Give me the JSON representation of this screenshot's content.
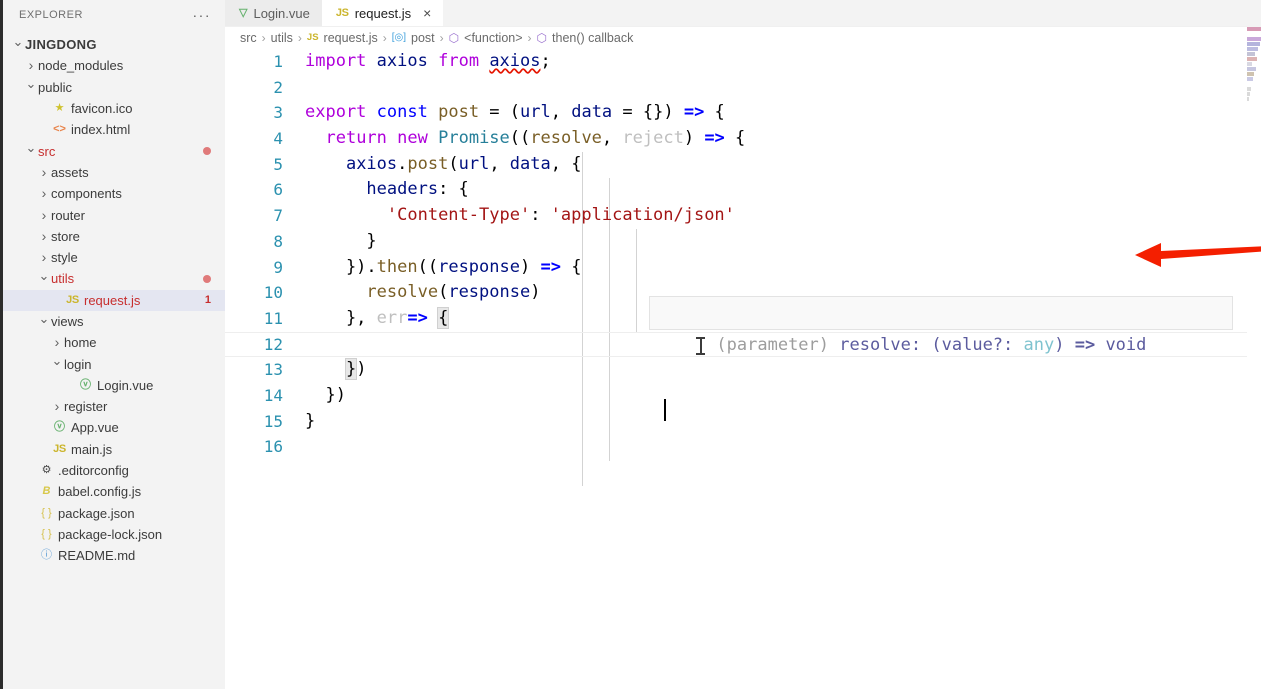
{
  "sidebar": {
    "title": "EXPLORER",
    "more_label": "···",
    "items": [
      {
        "label": "JINGDONG",
        "indent": 0,
        "twisty": "down",
        "icon": "",
        "kind": "root",
        "badge": ""
      },
      {
        "label": "node_modules",
        "indent": 1,
        "twisty": "right",
        "icon": "",
        "kind": "folder",
        "badge": ""
      },
      {
        "label": "public",
        "indent": 1,
        "twisty": "down",
        "icon": "",
        "kind": "folder",
        "badge": ""
      },
      {
        "label": "favicon.ico",
        "indent": 2,
        "twisty": "",
        "icon": "star-icon",
        "kind": "file",
        "badge": ""
      },
      {
        "label": "index.html",
        "indent": 2,
        "twisty": "",
        "icon": "html-icon",
        "kind": "file",
        "badge": ""
      },
      {
        "label": "src",
        "indent": 1,
        "twisty": "down",
        "icon": "",
        "kind": "folder-error",
        "badge": "dot"
      },
      {
        "label": "assets",
        "indent": 2,
        "twisty": "right",
        "icon": "",
        "kind": "folder",
        "badge": ""
      },
      {
        "label": "components",
        "indent": 2,
        "twisty": "right",
        "icon": "",
        "kind": "folder",
        "badge": ""
      },
      {
        "label": "router",
        "indent": 2,
        "twisty": "right",
        "icon": "",
        "kind": "folder",
        "badge": ""
      },
      {
        "label": "store",
        "indent": 2,
        "twisty": "right",
        "icon": "",
        "kind": "folder",
        "badge": ""
      },
      {
        "label": "style",
        "indent": 2,
        "twisty": "right",
        "icon": "",
        "kind": "folder",
        "badge": ""
      },
      {
        "label": "utils",
        "indent": 2,
        "twisty": "down",
        "icon": "",
        "kind": "folder-error",
        "badge": "dot"
      },
      {
        "label": "request.js",
        "indent": 3,
        "twisty": "",
        "icon": "js-icon",
        "kind": "file-error-selected",
        "badge": "1"
      },
      {
        "label": "views",
        "indent": 2,
        "twisty": "down",
        "icon": "",
        "kind": "folder",
        "badge": ""
      },
      {
        "label": "home",
        "indent": 3,
        "twisty": "right",
        "icon": "",
        "kind": "folder",
        "badge": ""
      },
      {
        "label": "login",
        "indent": 3,
        "twisty": "down",
        "icon": "",
        "kind": "folder",
        "badge": ""
      },
      {
        "label": "Login.vue",
        "indent": 4,
        "twisty": "",
        "icon": "vue-icon",
        "kind": "file",
        "badge": ""
      },
      {
        "label": "register",
        "indent": 3,
        "twisty": "right",
        "icon": "",
        "kind": "folder",
        "badge": ""
      },
      {
        "label": "App.vue",
        "indent": 2,
        "twisty": "",
        "icon": "vue-icon",
        "kind": "file",
        "badge": ""
      },
      {
        "label": "main.js",
        "indent": 2,
        "twisty": "",
        "icon": "js-icon",
        "kind": "file",
        "badge": ""
      },
      {
        "label": ".editorconfig",
        "indent": 1,
        "twisty": "",
        "icon": "gear-icon",
        "kind": "file",
        "badge": ""
      },
      {
        "label": "babel.config.js",
        "indent": 1,
        "twisty": "",
        "icon": "babel-icon",
        "kind": "file",
        "badge": ""
      },
      {
        "label": "package.json",
        "indent": 1,
        "twisty": "",
        "icon": "json-icon",
        "kind": "file",
        "badge": ""
      },
      {
        "label": "package-lock.json",
        "indent": 1,
        "twisty": "",
        "icon": "json-icon",
        "kind": "file",
        "badge": ""
      },
      {
        "label": "README.md",
        "indent": 1,
        "twisty": "",
        "icon": "md-icon",
        "kind": "file",
        "badge": ""
      }
    ]
  },
  "tabs": [
    {
      "label": "Login.vue",
      "icon": "vue-icon",
      "active": false,
      "closeable": false
    },
    {
      "label": "request.js",
      "icon": "js-icon",
      "active": true,
      "closeable": true,
      "close_label": "×"
    }
  ],
  "breadcrumbs": [
    {
      "label": "src",
      "icon": ""
    },
    {
      "label": "utils",
      "icon": ""
    },
    {
      "label": "request.js",
      "icon": "js-icon"
    },
    {
      "label": "post",
      "icon": "method-icon"
    },
    {
      "label": "<function>",
      "icon": "function-icon"
    },
    {
      "label": "then() callback",
      "icon": "function-icon"
    }
  ],
  "breadcrumb_separator": "›",
  "editor": {
    "line_numbers": [
      "1",
      "2",
      "3",
      "4",
      "5",
      "6",
      "7",
      "8",
      "9",
      "10",
      "11",
      "12",
      "13",
      "14",
      "15",
      "16"
    ],
    "lines": [
      "import axios from axios;",
      "",
      "export const post = (url, data = {}) => {",
      "  return new Promise((resolve, reject) => {",
      "    axios.post(url, data, {",
      "      headers: {",
      "        'Content-Type': 'application/json'",
      "      }",
      "    }).then((response) => {",
      "      resolve(response)",
      "    }, err=> {",
      "",
      "    })",
      "  })",
      "}",
      ""
    ],
    "current_line": 12,
    "cursor_line": 12
  },
  "hover_tooltip": {
    "prefix": "(parameter)",
    "name": " resolve",
    "colon": ": ",
    "signature_param": "(value?: ",
    "signature_type": "any",
    "signature_close": ") ",
    "signature_arrow": "=> ",
    "signature_return": "void"
  },
  "annotation": {
    "type": "red-arrow",
    "color": "#f41f00",
    "points_to_line": 7
  },
  "colors": {
    "keyword": "#af00db",
    "const": "#0000ff",
    "variable": "#001080",
    "function": "#795e26",
    "class": "#267f99",
    "string": "#a31515",
    "error": "#c72e2e",
    "line_number": "#2b91af",
    "sidebar_bg": "#f3f3f3",
    "selected_row": "#e4e6f1",
    "squiggle": "#e51400"
  }
}
